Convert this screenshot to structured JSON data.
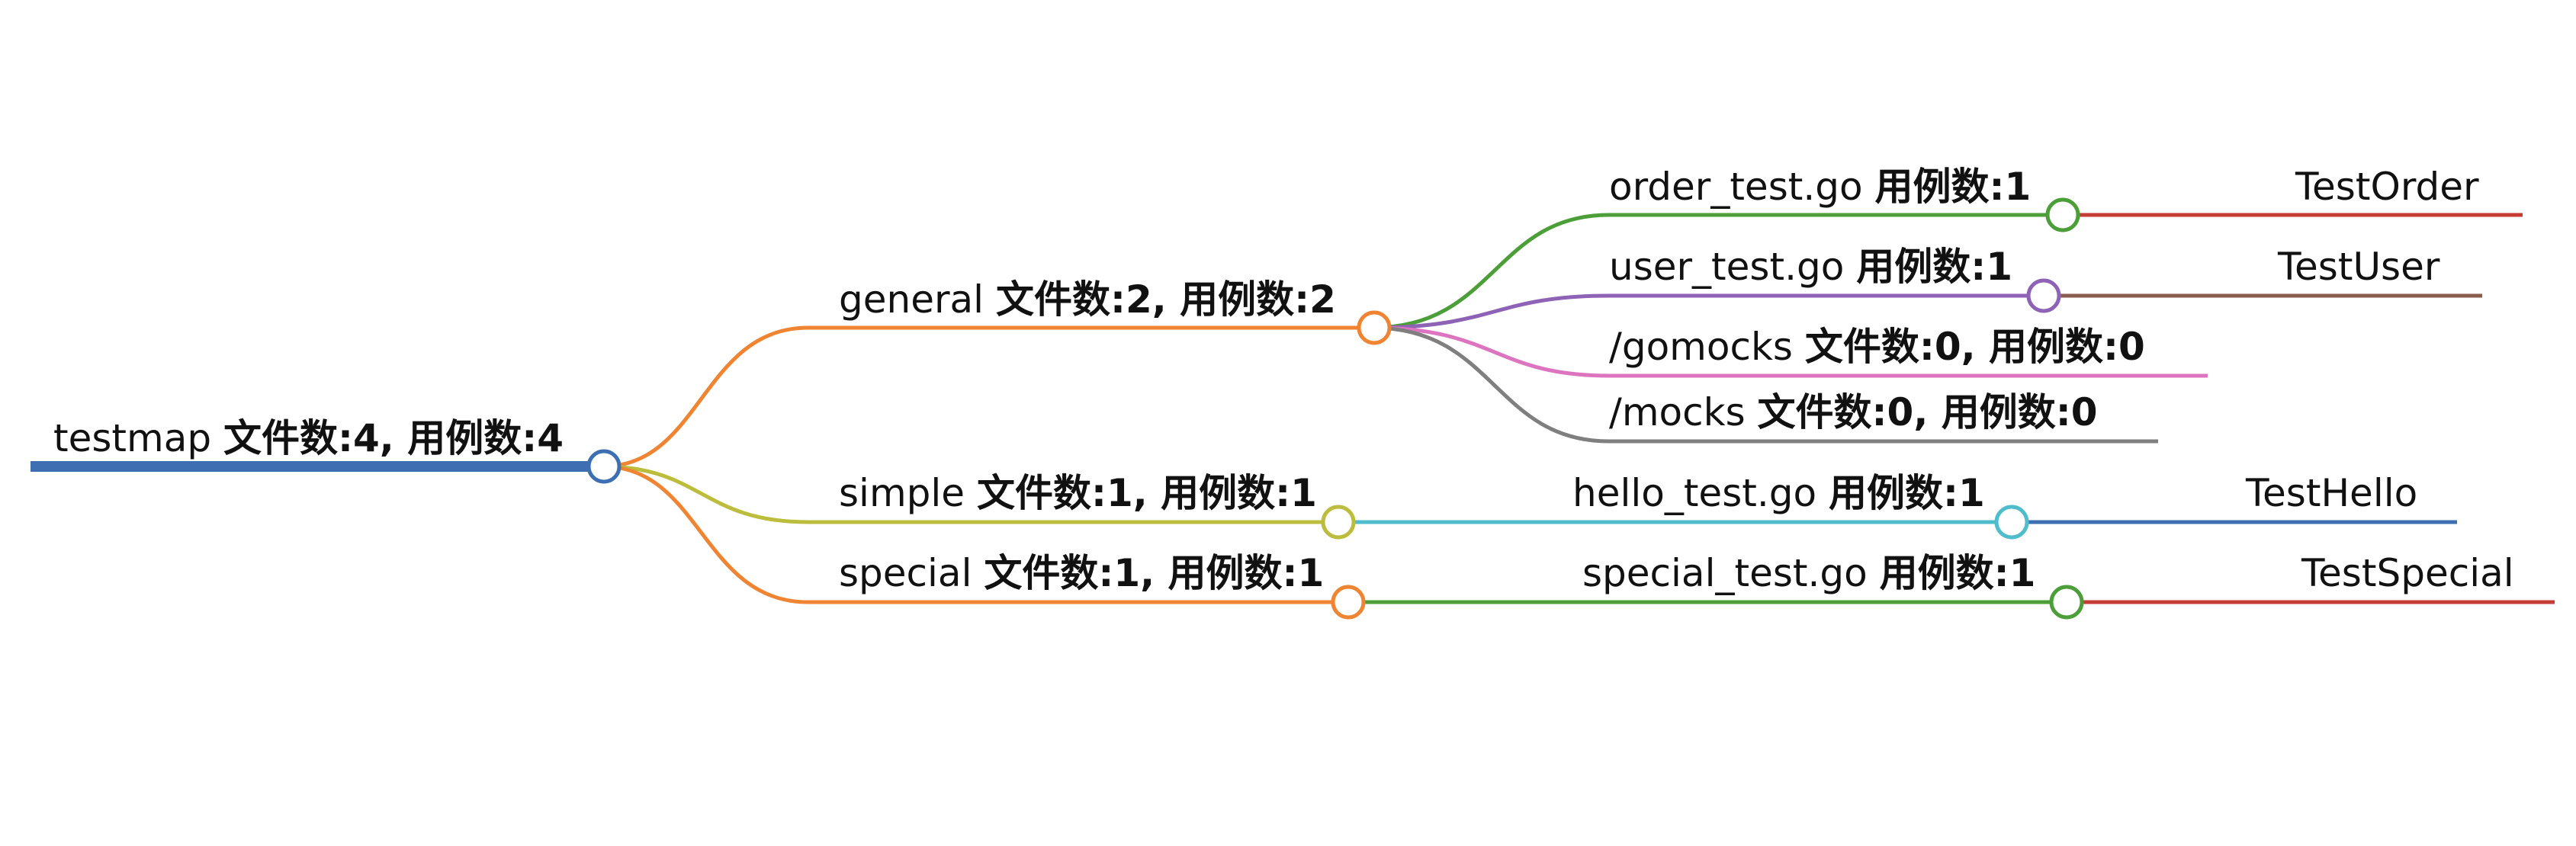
{
  "root": {
    "name": "testmap",
    "summary": "文件数:4, 用例数:4",
    "color": "#3d6fb2"
  },
  "branches": [
    {
      "id": "general",
      "name": "general",
      "summary": "文件数:2, 用例数:2",
      "color": "#ef8533",
      "children": [
        {
          "id": "order",
          "name": "order_test.go",
          "summary": "用例数:1",
          "color": "#4c9f38",
          "leaf": {
            "name": "TestOrder",
            "color": "#c43c34"
          }
        },
        {
          "id": "user",
          "name": "user_test.go",
          "summary": "用例数:1",
          "color": "#8e63b6",
          "leaf": {
            "name": "TestUser",
            "color": "#8a5c4e"
          }
        },
        {
          "id": "gomocks",
          "name": "/gomocks",
          "summary": "文件数:0, 用例数:0",
          "color": "#dc74c0",
          "leaf": null
        },
        {
          "id": "mocks",
          "name": "/mocks",
          "summary": "文件数:0, 用例数:0",
          "color": "#7f7f7f",
          "leaf": null
        }
      ]
    },
    {
      "id": "simple",
      "name": "simple",
      "summary": "文件数:1, 用例数:1",
      "color": "#bcbd3c",
      "children": [
        {
          "id": "hello",
          "name": "hello_test.go",
          "summary": "用例数:1",
          "color": "#4fbdcc",
          "leaf": {
            "name": "TestHello",
            "color": "#3d6fb2"
          }
        }
      ]
    },
    {
      "id": "special",
      "name": "special",
      "summary": "文件数:1, 用例数:1",
      "color": "#ef8533",
      "children": [
        {
          "id": "specialtest",
          "name": "special_test.go",
          "summary": "用例数:1",
          "color": "#4c9f38",
          "leaf": {
            "name": "TestSpecial",
            "color": "#c43c34"
          }
        }
      ]
    }
  ]
}
